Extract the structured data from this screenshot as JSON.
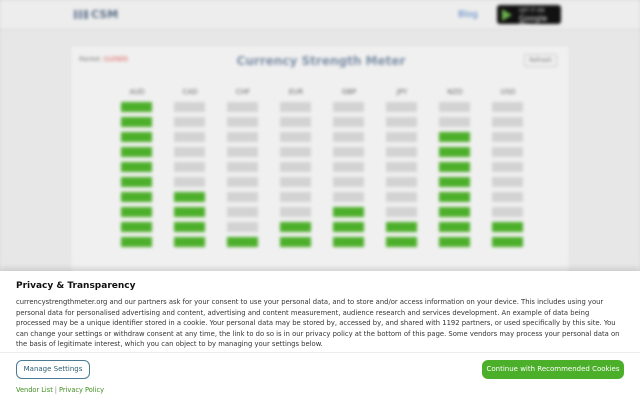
{
  "header": {
    "logo_text": "CSM",
    "blog_label": "Blog",
    "google_play": {
      "small": "GET IT ON",
      "big": "Google Play"
    }
  },
  "meter": {
    "market_label": "Market:",
    "market_status": "CLOSED",
    "title": "Currency Strength Meter",
    "refresh_label": "Refresh",
    "currencies": [
      {
        "code": "AUD",
        "strength": 10
      },
      {
        "code": "CAD",
        "strength": 4
      },
      {
        "code": "CHF",
        "strength": 1
      },
      {
        "code": "EUR",
        "strength": 2
      },
      {
        "code": "GBP",
        "strength": 3
      },
      {
        "code": "JPY",
        "strength": 2
      },
      {
        "code": "NZD",
        "strength": 8
      },
      {
        "code": "USD",
        "strength": 2
      }
    ],
    "max_level": 10,
    "colors": {
      "on": "#4caf2a",
      "off": "#d3d3d3"
    }
  },
  "consent": {
    "title": "Privacy & Transparency",
    "body": "currencystrengthmeter.org and our partners ask for your consent to use your personal data, and to store and/or access information on your device. This includes using your personal data for personalised advertising and content, advertising and content measurement, audience research and services development. An example of data being processed may be a unique identifier stored in a cookie. Your personal data may be stored by, accessed by, and shared with 1192 partners, or used specifically by this site. You can change your settings or withdraw consent at any time, the link to do so is in our privacy policy at the bottom of this page. Some vendors may process your personal data on the basis of legitimate interest, which you can object to by managing your settings below.",
    "manage_label": "Manage Settings",
    "continue_label": "Continue with Recommended Cookies",
    "vendor_list_label": "Vendor List",
    "separator": "|",
    "privacy_policy_label": "Privacy Policy",
    "accent_color": "#4caf2a"
  }
}
